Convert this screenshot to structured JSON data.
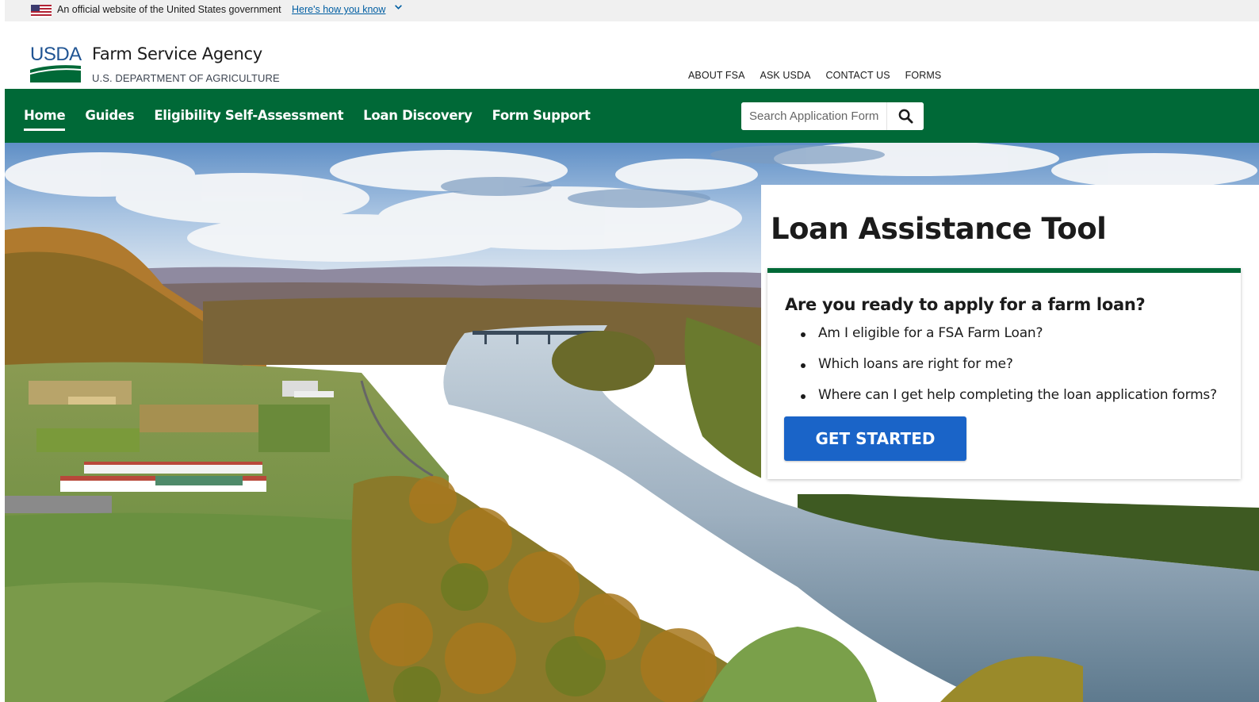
{
  "gov_banner": {
    "text": "An official website of the United States government",
    "link": "Here's how you know",
    "flag_icon": "us-flag-icon",
    "chevron_icon": "chevron-down-icon"
  },
  "header": {
    "logo_text": "USDA",
    "agency_name": "Farm Service Agency",
    "department": "U.S. DEPARTMENT OF AGRICULTURE",
    "utility_links": [
      "ABOUT FSA",
      "ASK USDA",
      "CONTACT US",
      "FORMS"
    ]
  },
  "nav": {
    "items": [
      {
        "label": "Home",
        "active": true
      },
      {
        "label": "Guides",
        "active": false
      },
      {
        "label": "Eligibility Self-Assessment",
        "active": false
      },
      {
        "label": "Loan Discovery",
        "active": false
      },
      {
        "label": "Form Support",
        "active": false
      }
    ],
    "search_placeholder": "Search Application Forms",
    "search_icon": "magnifier-icon"
  },
  "card": {
    "title": "Loan Assistance Tool",
    "subtitle": "Are you ready to apply for a farm loan?",
    "questions": [
      "Am I eligible for a FSA Farm Loan?",
      "Which loans are right for me?",
      "Where can I get help completing the loan application forms?"
    ],
    "cta_label": "GET STARTED"
  },
  "colors": {
    "nav_green": "#006937",
    "cta_blue": "#1a64c8",
    "usda_blue": "#205493",
    "link_blue": "#005ea2"
  }
}
